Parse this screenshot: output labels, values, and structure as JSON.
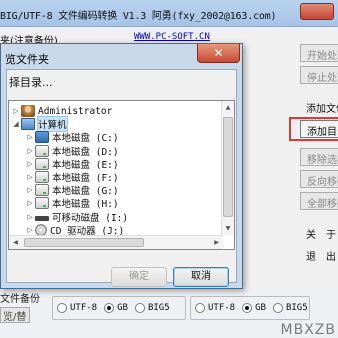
{
  "app": {
    "title": "BIG/UTF-8 文件编码转换 V1.3  阿勇(fxy_2002@163.com)",
    "header_label": "夹(注意备份)",
    "website": "WWW.PC-SOFT.CN"
  },
  "right_buttons": [
    {
      "label": "开始处理",
      "enabled": false
    },
    {
      "label": "停止处理",
      "enabled": false
    },
    {
      "label": "添加目录",
      "enabled": true
    },
    {
      "label": "移除选择",
      "enabled": false
    },
    {
      "label": "反向移除",
      "enabled": false
    },
    {
      "label": "全部移除",
      "enabled": false
    }
  ],
  "right_texts": {
    "add_file": "添加文件",
    "about": "关　于",
    "exit": "退　出"
  },
  "bottom": {
    "label": "文件备份",
    "label2": "览/替换",
    "group1": [
      {
        "label": "UTF-8",
        "checked": false
      },
      {
        "label": "GB",
        "checked": true
      },
      {
        "label": "BIG5",
        "checked": false
      }
    ],
    "group2": [
      {
        "label": "UTF-8",
        "checked": false
      },
      {
        "label": "GB",
        "checked": true
      },
      {
        "label": "BIG5",
        "checked": false
      }
    ]
  },
  "watermark": "MBXZB",
  "dialog": {
    "title": "览文件夹",
    "close_glyph": "✕",
    "prompt": "择目录...",
    "tree": [
      {
        "label": "Administrator",
        "icon": "user-folder-icon",
        "indent": 0,
        "expander": "▷",
        "selected": false
      },
      {
        "label": "计算机",
        "icon": "computer-icon",
        "indent": 0,
        "expander": "◢",
        "selected": true
      },
      {
        "label": "本地磁盘 (C:)",
        "icon": "system-drive-icon",
        "indent": 1,
        "expander": "▷",
        "selected": false
      },
      {
        "label": "本地磁盘 (D:)",
        "icon": "hard-drive-icon",
        "indent": 1,
        "expander": "▷",
        "selected": false
      },
      {
        "label": "本地磁盘 (E:)",
        "icon": "hard-drive-icon",
        "indent": 1,
        "expander": "▷",
        "selected": false
      },
      {
        "label": "本地磁盘 (F:)",
        "icon": "hard-drive-icon",
        "indent": 1,
        "expander": "▷",
        "selected": false
      },
      {
        "label": "本地磁盘 (G:)",
        "icon": "hard-drive-icon",
        "indent": 1,
        "expander": "▷",
        "selected": false
      },
      {
        "label": "本地磁盘 (H:)",
        "icon": "hard-drive-icon",
        "indent": 1,
        "expander": "▷",
        "selected": false
      },
      {
        "label": "可移动磁盘 (I:)",
        "icon": "usb-drive-icon",
        "indent": 1,
        "expander": "▷",
        "selected": false
      },
      {
        "label": "CD 驱动器 (J:)",
        "icon": "cd-drive-icon",
        "indent": 1,
        "expander": "▷",
        "selected": false
      }
    ],
    "ok_label": "确定",
    "cancel_label": "取消"
  }
}
